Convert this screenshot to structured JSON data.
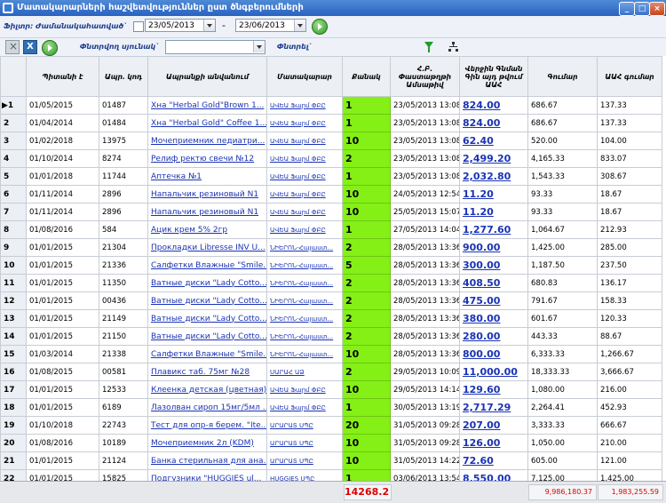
{
  "window": {
    "title": "Մատակարարների հաշվետվություններ ըստ ծնգբերումների"
  },
  "filter": {
    "label": "Ֆիլտր: Ժամանակահատված`",
    "date_from": "23/05/2013",
    "date_to": "23/06/2013",
    "dash": "-"
  },
  "toolbar": {
    "search_column_label": "Փնտրվող սյունակ`",
    "search_label": "Փնտրել`",
    "search_value": "",
    "excel_label": "X"
  },
  "columns": [
    "Պիտանի է",
    "Ապր. կոդ",
    "Ապրանքի անվանում",
    "Մատակարար",
    "Քանակ",
    "Հ.Բ. Փաստաթղթի Ամսաթիվ",
    "Վերջին Գնման Գին այդ թվում ԱԱՀ",
    "Գումար",
    "ԱԱՀ գումար"
  ],
  "rows": [
    {
      "n": "1",
      "date": "01/05/2015",
      "code": "01487",
      "name": "Хна \"Herbal Gold\"Brown 1...",
      "supplier": "ԱՎԵԱ Ֆարմ ՓԲԸ",
      "qty": "1",
      "doc": "23/05/2013 13:08",
      "price": "824.00",
      "sum": "686.67",
      "vat": "137.33"
    },
    {
      "n": "2",
      "date": "01/04/2014",
      "code": "01484",
      "name": "Хна \"Herbal Gold\" Coffee 1...",
      "supplier": "ԱՎԵԱ Ֆարմ ՓԲԸ",
      "qty": "1",
      "doc": "23/05/2013 13:08",
      "price": "824.00",
      "sum": "686.67",
      "vat": "137.33"
    },
    {
      "n": "3",
      "date": "01/02/2018",
      "code": "13975",
      "name": "Мочеприемник педиатри...",
      "supplier": "ԱՎԵԱ Ֆարմ ՓԲԸ",
      "qty": "10",
      "doc": "23/05/2013 13:08",
      "price": "62.40",
      "sum": "520.00",
      "vat": "104.00"
    },
    {
      "n": "4",
      "date": "01/10/2014",
      "code": "8274",
      "name": "Релиф ректю свечи №12",
      "supplier": "ԱՎԵԱ Ֆարմ ՓԲԸ",
      "qty": "2",
      "doc": "23/05/2013 13:08",
      "price": "2,499.20",
      "sum": "4,165.33",
      "vat": "833.07"
    },
    {
      "n": "5",
      "date": "01/01/2018",
      "code": "11744",
      "name": "Аптечка №1",
      "supplier": "ԱՎԵԱ Ֆարմ ՓԲԸ",
      "qty": "1",
      "doc": "23/05/2013 13:08",
      "price": "2,032.80",
      "sum": "1,543.33",
      "vat": "308.67"
    },
    {
      "n": "6",
      "date": "01/11/2014",
      "code": "2896",
      "name": "Напальчик резиновый N1",
      "supplier": "ԱՎԵԱ Ֆարմ ՓԲԸ",
      "qty": "10",
      "doc": "24/05/2013 12:54",
      "price": "11.20",
      "sum": "93.33",
      "vat": "18.67"
    },
    {
      "n": "7",
      "date": "01/11/2014",
      "code": "2896",
      "name": "Напальчик резиновый N1",
      "supplier": "ԱՎԵԱ Ֆարմ ՓԲԸ",
      "qty": "10",
      "doc": "25/05/2013 15:07",
      "price": "11.20",
      "sum": "93.33",
      "vat": "18.67"
    },
    {
      "n": "8",
      "date": "01/08/2016",
      "code": "584",
      "name": "Ацик крем 5% 2гр",
      "supplier": "ԱՎԵԱ Ֆարմ ՓԲԸ",
      "qty": "1",
      "doc": "27/05/2013 14:04",
      "price": "1,277.60",
      "sum": "1,064.67",
      "vat": "212.93"
    },
    {
      "n": "9",
      "date": "01/01/2015",
      "code": "21304",
      "name": "Прокладки Libresse INV U...",
      "supplier": "ՆԻԵՐՈՆ-Հայաստ...",
      "qty": "2",
      "doc": "28/05/2013 13:36",
      "price": "900.00",
      "sum": "1,425.00",
      "vat": "285.00"
    },
    {
      "n": "10",
      "date": "01/01/2015",
      "code": "21336",
      "name": "Салфетки Влажные \"Smile...",
      "supplier": "ՆԻԵՐՈՆ-Հայաստ...",
      "qty": "5",
      "doc": "28/05/2013 13:36",
      "price": "300.00",
      "sum": "1,187.50",
      "vat": "237.50"
    },
    {
      "n": "11",
      "date": "01/01/2015",
      "code": "11350",
      "name": "Ватные диски \"Lady Cotto...",
      "supplier": "ՆԻԵՐՈՆ-Հայաստ...",
      "qty": "2",
      "doc": "28/05/2013 13:36",
      "price": "408.50",
      "sum": "680.83",
      "vat": "136.17"
    },
    {
      "n": "12",
      "date": "01/01/2015",
      "code": "00436",
      "name": "Ватные диски \"Lady Cotto...",
      "supplier": "ՆԻԵՐՈՆ-Հայաստ...",
      "qty": "2",
      "doc": "28/05/2013 13:36",
      "price": "475.00",
      "sum": "791.67",
      "vat": "158.33"
    },
    {
      "n": "13",
      "date": "01/01/2015",
      "code": "21149",
      "name": "Ватные диски \"Lady Cotto...",
      "supplier": "ՆԻԵՐՈՆ-Հայաստ...",
      "qty": "2",
      "doc": "28/05/2013 13:36",
      "price": "380.00",
      "sum": "601.67",
      "vat": "120.33"
    },
    {
      "n": "14",
      "date": "01/01/2015",
      "code": "21150",
      "name": "Ватные диски \"Lady Cotto...",
      "supplier": "ՆԻԵՐՈՆ-Հայաստ...",
      "qty": "2",
      "doc": "28/05/2013 13:36",
      "price": "280.00",
      "sum": "443.33",
      "vat": "88.67"
    },
    {
      "n": "15",
      "date": "01/03/2014",
      "code": "21338",
      "name": "Салфетки Влажные \"Smile...",
      "supplier": "ՆԻԵՐՈՆ-Հայաստ...",
      "qty": "10",
      "doc": "28/05/2013 13:36",
      "price": "800.00",
      "sum": "6,333.33",
      "vat": "1,266.67"
    },
    {
      "n": "16",
      "date": "01/08/2015",
      "code": "00581",
      "name": "Плавикс таб. 75мг №28",
      "supplier": "ՍԱՐԱՀ ԱՁ",
      "qty": "2",
      "doc": "29/05/2013 10:09",
      "price": "11,000.00",
      "sum": "18,333.33",
      "vat": "3,666.67"
    },
    {
      "n": "17",
      "date": "01/01/2015",
      "code": "12533",
      "name": "Клеенка детская (цветная)...",
      "supplier": "ԱՎԵԱ Ֆարմ ՓԲԸ",
      "qty": "10",
      "doc": "29/05/2013 14:14",
      "price": "129.60",
      "sum": "1,080.00",
      "vat": "216.00"
    },
    {
      "n": "18",
      "date": "01/01/2015",
      "code": "6189",
      "name": "Лазолван сироп 15мг/5мл ...",
      "supplier": "ԱՎԵԱ Ֆարմ ՓԲԸ",
      "qty": "1",
      "doc": "30/05/2013 13:19",
      "price": "2,717.29",
      "sum": "2,264.41",
      "vat": "452.93"
    },
    {
      "n": "19",
      "date": "01/10/2018",
      "code": "22743",
      "name": "Тест для опр-я берем. \"Ite...",
      "supplier": "ԱՐԱՐԱՏ ՍՊԸ",
      "qty": "20",
      "doc": "31/05/2013 09:28",
      "price": "207.00",
      "sum": "3,333.33",
      "vat": "666.67"
    },
    {
      "n": "20",
      "date": "01/08/2016",
      "code": "10189",
      "name": "Мочеприемник 2л (KDM)",
      "supplier": "ԱՐԱՐԱՏ ՍՊԸ",
      "qty": "10",
      "doc": "31/05/2013 09:28",
      "price": "126.00",
      "sum": "1,050.00",
      "vat": "210.00"
    },
    {
      "n": "21",
      "date": "01/01/2015",
      "code": "21124",
      "name": "Банка стерильная для ана...",
      "supplier": "ԱՐԱՐԱՏ ՍՊԸ",
      "qty": "10",
      "doc": "31/05/2013 14:22",
      "price": "72.60",
      "sum": "605.00",
      "vat": "121.00"
    },
    {
      "n": "22",
      "date": "01/01/2015",
      "code": "15825",
      "name": "Подгузники \"HUGGIES ul...",
      "supplier": "HUGGIES ՍՊԸ",
      "qty": "1",
      "doc": "03/06/2013 13:54",
      "price": "8,550.00",
      "sum": "7,125.00",
      "vat": "1,425.00"
    }
  ],
  "totals": {
    "qty": "14268.2",
    "sum": "9,986,180.37",
    "vat": "1,983,255.59"
  },
  "colors": {
    "qty_highlight": "#84f016",
    "link": "#1a33b5",
    "total_text": "#dd0000"
  }
}
